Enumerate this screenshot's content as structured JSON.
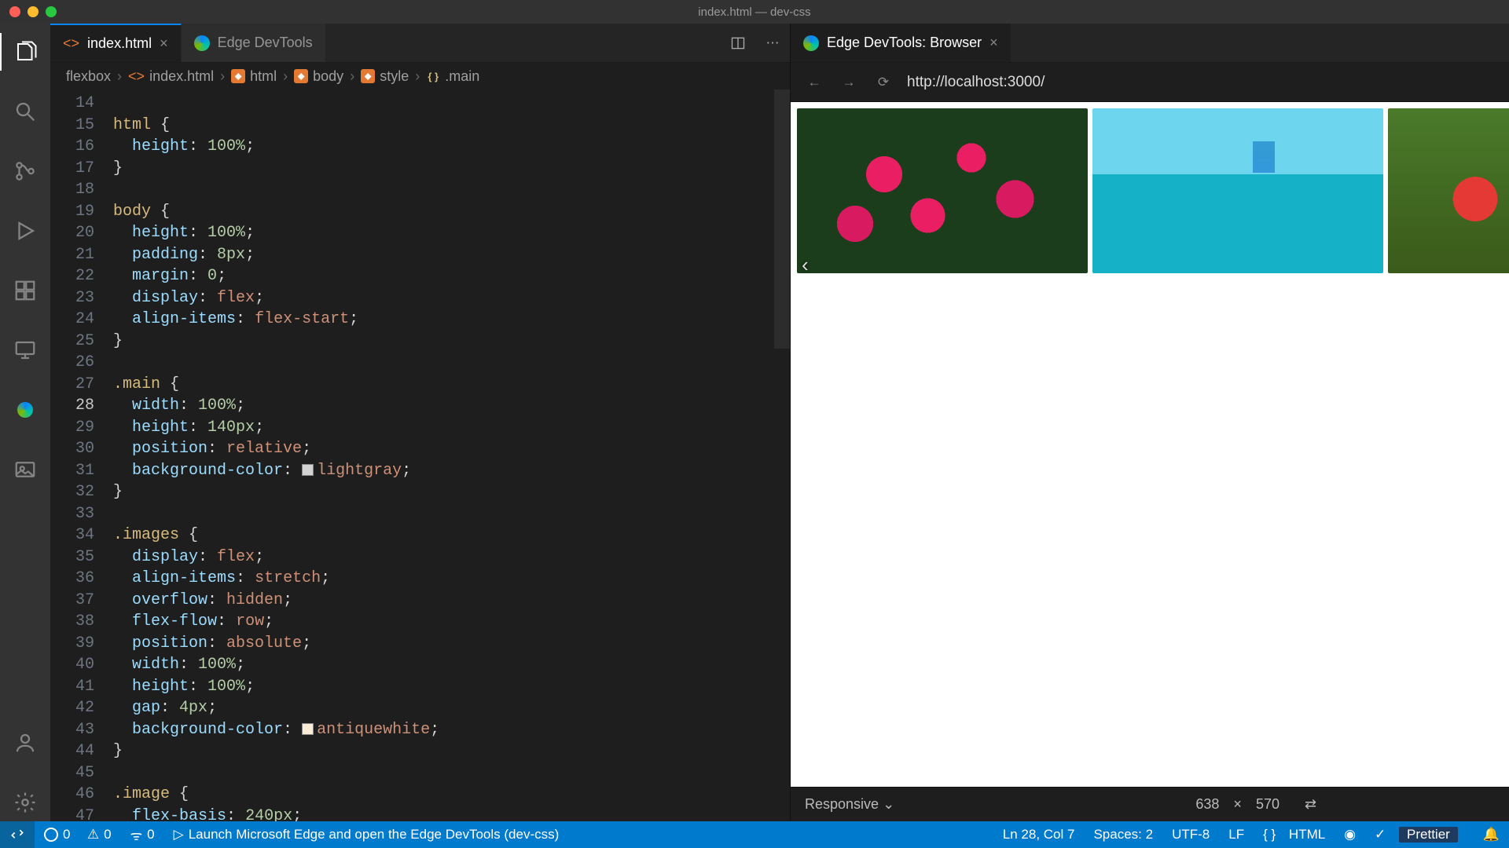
{
  "window": {
    "title": "index.html — dev-css"
  },
  "tabs_left": [
    {
      "label": "index.html",
      "icon": "html-file",
      "active": true,
      "close": "×"
    },
    {
      "label": "Edge DevTools",
      "icon": "edge",
      "active": false,
      "close": ""
    }
  ],
  "tabs_right": [
    {
      "label": "Edge DevTools: Browser",
      "icon": "edge",
      "active": true,
      "close": "×"
    }
  ],
  "breadcrumb": [
    "flexbox",
    "index.html",
    "html",
    "body",
    "style",
    ".main"
  ],
  "gutter_start": 14,
  "code_lines": [
    "",
    "html {",
    "  height: 100%;",
    "}",
    "",
    "body {",
    "  height: 100%;",
    "  padding: 8px;",
    "  margin: 0;",
    "  display: flex;",
    "  align-items: flex-start;",
    "}",
    "",
    ".main {",
    "  width: 100%;",
    "  height: 140px;",
    "  position: relative;",
    "  background-color: lightgray;",
    "}",
    "",
    ".images {",
    "  display: flex;",
    "  align-items: stretch;",
    "  overflow: hidden;",
    "  flex-flow: row;",
    "  position: absolute;",
    "  width: 100%;",
    "  height: 100%;",
    "  gap: 4px;",
    "  background-color: antiquewhite;",
    "}",
    "",
    ".image {",
    "  flex-basis: 240px;"
  ],
  "cursor_line_number": 28,
  "browser": {
    "url": "http://localhost:3000/"
  },
  "device_toolbar": {
    "mode": "Responsive",
    "width": "638",
    "sep": "×",
    "height": "570"
  },
  "statusbar": {
    "errors": "0",
    "warnings": "0",
    "ports": "0",
    "launch_hint": "Launch Microsoft Edge and open the Edge DevTools (dev-css)",
    "cursor": "Ln 28, Col 7",
    "spaces": "Spaces: 2",
    "encoding": "UTF-8",
    "eol": "LF",
    "language": "HTML",
    "prettier": "Prettier"
  }
}
